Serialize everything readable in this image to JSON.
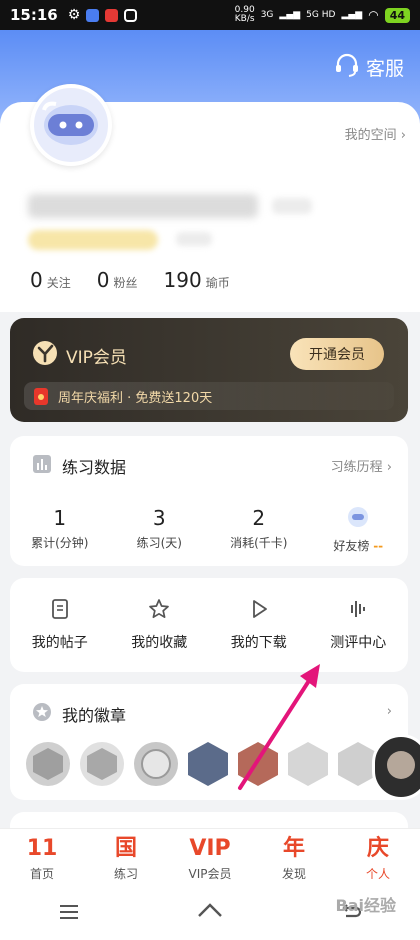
{
  "status_bar": {
    "time": "15:16",
    "speed_value": "0.90",
    "speed_unit": "KB/s",
    "network": "3G",
    "network2": "5G HD",
    "battery": "44"
  },
  "header": {
    "service_label": "客服"
  },
  "profile": {
    "my_space": "我的空间",
    "follow_count": "0",
    "follow_label": "关注",
    "fans_count": "0",
    "fans_label": "粉丝",
    "coins_count": "190",
    "coins_label": "瑜币"
  },
  "vip": {
    "title": "VIP会员",
    "button": "开通会员",
    "promo": "周年庆福利 · 免费送120天"
  },
  "practice": {
    "title": "练习数据",
    "link": "习练历程",
    "stats": [
      {
        "value": "1",
        "label": "累计(分钟)"
      },
      {
        "value": "3",
        "label": "练习(天)"
      },
      {
        "value": "2",
        "label": "消耗(千卡)"
      }
    ],
    "ranking_label": "好友榜",
    "ranking_value": "--"
  },
  "tools": [
    {
      "label": "我的帖子",
      "icon": "document-icon"
    },
    {
      "label": "我的收藏",
      "icon": "star-icon"
    },
    {
      "label": "我的下载",
      "icon": "play-icon"
    },
    {
      "label": "测评中心",
      "icon": "waveform-icon"
    }
  ],
  "badges": {
    "title": "我的徽章"
  },
  "tabbar": [
    {
      "glyph": "11",
      "label": "首页"
    },
    {
      "glyph": "国",
      "label": "练习"
    },
    {
      "glyph": "VIP",
      "label": "VIP会员"
    },
    {
      "glyph": "年",
      "label": "发现"
    },
    {
      "glyph": "庆",
      "label": "个人",
      "active": true
    }
  ],
  "watermark": "Bai经验",
  "colors": {
    "accent": "#e8482a",
    "header_blue": "#5c8df5",
    "vip_gold": "#f2d9a8",
    "arrow": "#e3157a"
  }
}
